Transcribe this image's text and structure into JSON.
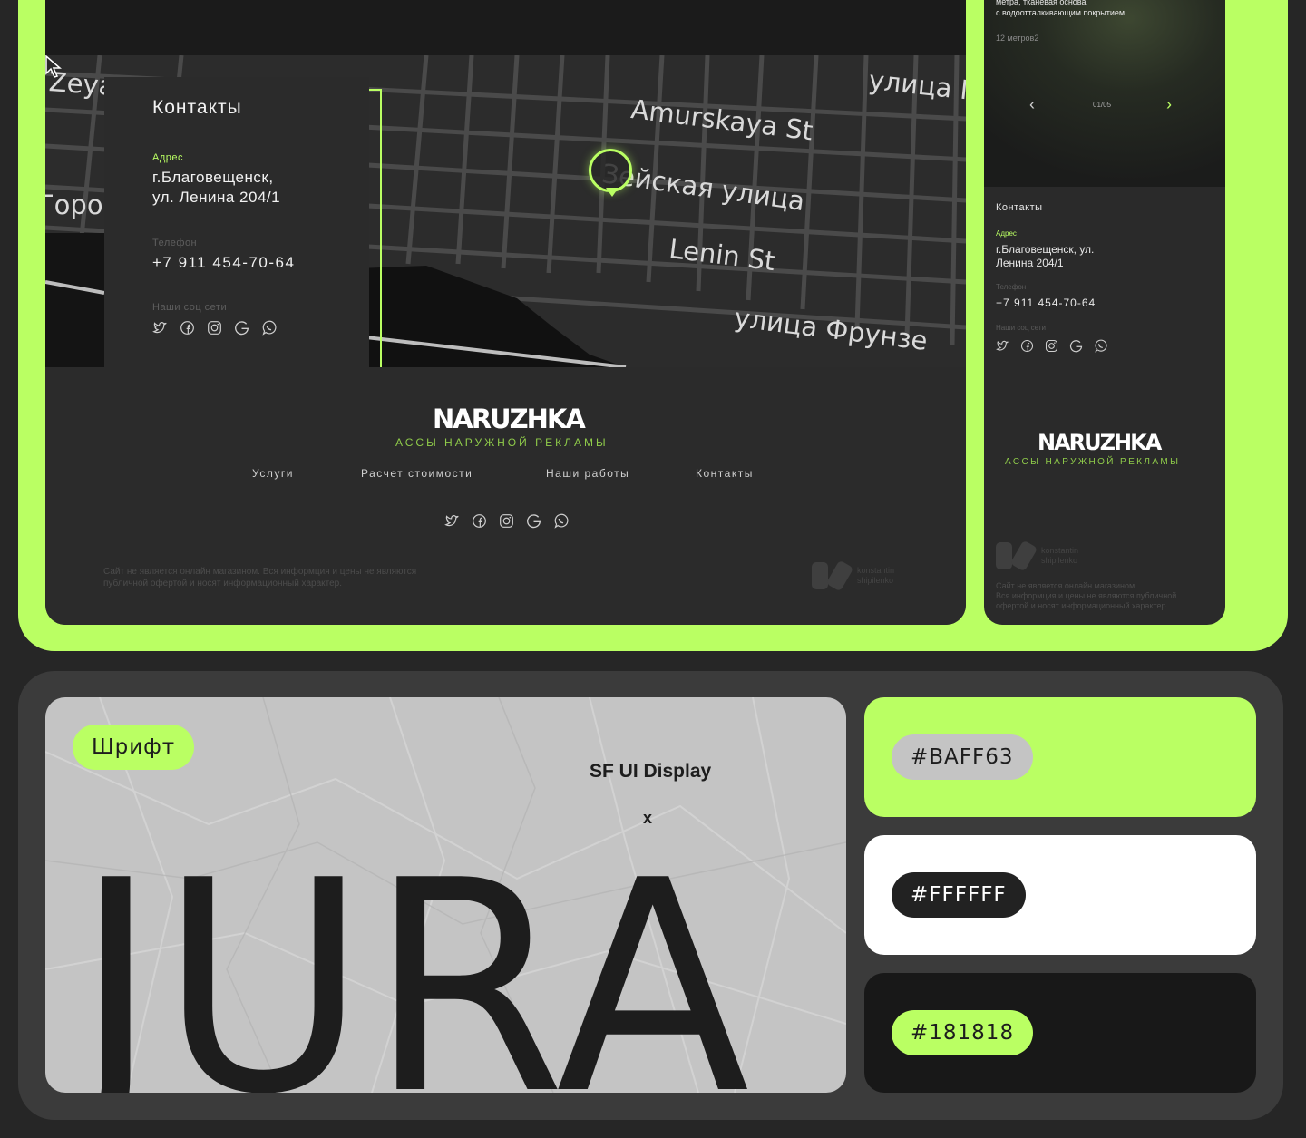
{
  "colors": {
    "accent": "#baff63",
    "white": "#ffffff",
    "dark": "#181818"
  },
  "desktop": {
    "map": {
      "labels": [
        "Zeya",
        "Amurskaya St",
        "улица Г",
        "Горо",
        "Зейская улица",
        "Lenin St",
        "улица Фрунзе"
      ]
    },
    "contacts": {
      "title": "Контакты",
      "address_label": "Адрес",
      "address_line1": "г.Благовещенск,",
      "address_line2": "ул. Ленина 204/1",
      "phone_label": "Телефон",
      "phone": "+7 911 454-70-64",
      "social_label": "Наши соц сети",
      "social_icons": [
        "twitter-icon",
        "facebook-icon",
        "instagram-icon",
        "google-icon",
        "whatsapp-icon"
      ]
    },
    "footer": {
      "logo": "NARUZHKA",
      "tagline": "АССЫ НАРУЖНОЙ РЕКЛАМЫ",
      "nav": [
        "Услуги",
        "Расчет стоимости",
        "Наши работы",
        "Контакты"
      ],
      "disclaimer_line1": "Сайт не является онлайн магазином. Вся информция и цены не являются",
      "disclaimer_line2": "публичной офертой и носят информационный характер.",
      "author_line1": "konstantin",
      "author_line2": "shipilenko"
    }
  },
  "mobile": {
    "hero_line1": "метра, тканевая основа",
    "hero_line2": "с водоотталкивающим покрытием",
    "hero_sub": "12 метров2",
    "pager": "01/05",
    "contacts_title": "Контакты",
    "address_label": "Адрес",
    "address_line1": "г.Благовещенск, ул.",
    "address_line2": "Ленина 204/1",
    "phone_label": "Телефон",
    "phone": "+7 911 454-70-64",
    "social_label": "Наши соц сети",
    "logo": "NARUZHKA",
    "tagline": "АССЫ НАРУЖНОЙ РЕКЛАМЫ",
    "author_line1": "konstantin",
    "author_line2": "shipilenko",
    "disclaimer_line1": "Сайт не является онлайн магазином.",
    "disclaimer_line2": "Вся информция и цены не являются публичной",
    "disclaimer_line3": "офертой и носят информационный характер."
  },
  "typography": {
    "tag": "Шрифт",
    "font_name": "SF UI Display",
    "separator": "x",
    "sample": "JURA"
  },
  "palette": [
    {
      "hex_label": "#BAFF63",
      "swatch": "#baff63",
      "pill_bg": "#c4c4c4",
      "pill_text": "#1d1d1d"
    },
    {
      "hex_label": "#FFFFFF",
      "swatch": "#ffffff",
      "pill_bg": "#222222",
      "pill_text": "#ffffff"
    },
    {
      "hex_label": "#181818",
      "swatch": "#181818",
      "pill_bg": "#baff63",
      "pill_text": "#1d1d1d"
    }
  ]
}
